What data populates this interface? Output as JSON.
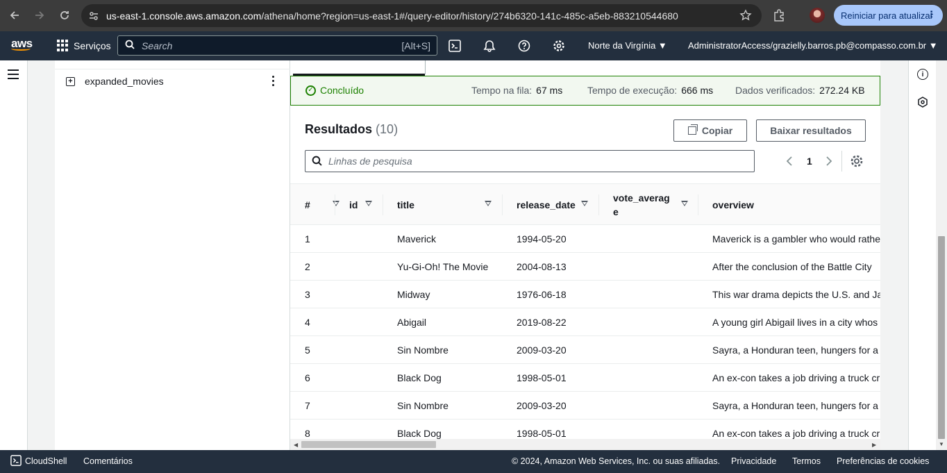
{
  "browser": {
    "url_host": "us-east-1.console.aws.amazon.com",
    "url_path": "/athena/home?region=us-east-1#/query-editor/history/274b6320-141c-485c-a5eb-883210544680",
    "update_label": "Reiniciar para atualizar"
  },
  "aws_nav": {
    "logo_text": "aws",
    "services_label": "Serviços",
    "search_placeholder": "Search",
    "search_shortcut": "[Alt+S]",
    "region_label": "Norte da Virgínia ▼",
    "account_label": "AdministratorAccess/grazielly.barros.pb@compasso.com.br ▼",
    "accent_color": "#ff9900"
  },
  "tables_panel": {
    "item_label": "expanded_movies"
  },
  "status": {
    "state": "Concluído",
    "queue_label": "Tempo na fila:",
    "queue_value": "67 ms",
    "exec_label": "Tempo de execução:",
    "exec_value": "666 ms",
    "scanned_label": "Dados verificados:",
    "scanned_value": "272.24 KB",
    "color": "#1d8102"
  },
  "results": {
    "title": "Resultados",
    "count": "(10)",
    "copy_label": "Copiar",
    "download_label": "Baixar resultados",
    "filter_placeholder": "Linhas de pesquisa",
    "page": "1",
    "columns": [
      "#",
      "id",
      "title",
      "release_date",
      "vote_averag\ne",
      "overview"
    ],
    "rows": [
      [
        "1",
        "",
        "Maverick",
        "1994-05-20",
        "",
        "Maverick is a gambler who would rathe"
      ],
      [
        "2",
        "",
        "Yu-Gi-Oh! The Movie",
        "2004-08-13",
        "",
        "After the conclusion of the Battle City"
      ],
      [
        "3",
        "",
        "Midway",
        "1976-06-18",
        "",
        "This war drama depicts the U.S. and Ja"
      ],
      [
        "4",
        "",
        "Abigail",
        "2019-08-22",
        "",
        "A young girl Abigail lives in a city whos"
      ],
      [
        "5",
        "",
        "Sin Nombre",
        "2009-03-20",
        "",
        "Sayra, a Honduran teen, hungers for a"
      ],
      [
        "6",
        "",
        "Black Dog",
        "1998-05-01",
        "",
        "An ex-con takes a job driving a truck cr"
      ],
      [
        "7",
        "",
        "Sin Nombre",
        "2009-03-20",
        "",
        "Sayra, a Honduran teen, hungers for a"
      ],
      [
        "8",
        "",
        "Black Dog",
        "1998-05-01",
        "",
        "An ex-con takes a job driving a truck cr"
      ]
    ]
  },
  "footer": {
    "cloudshell": "CloudShell",
    "feedback": "Comentários",
    "copyright": "© 2024, Amazon Web Services, Inc. ou suas afiliadas.",
    "privacy": "Privacidade",
    "terms": "Termos",
    "cookies": "Preferências de cookies"
  }
}
